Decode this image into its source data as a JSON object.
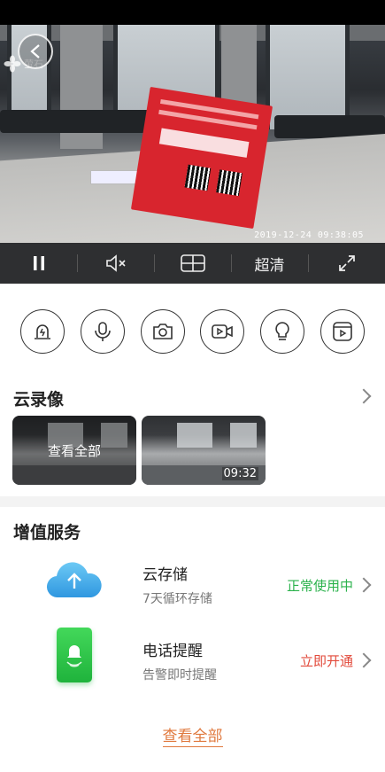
{
  "video": {
    "watermark": "萤石",
    "timestamp": "2019-12-24 09:38:05",
    "sign_title": "智能家居",
    "sign_subtitle": "Home Smart",
    "sign_header": "欢迎订阅《智能家居》杂志"
  },
  "controls": {
    "quality_label": "超清",
    "items": [
      "pause-icon",
      "mute-icon",
      "multi-view-icon",
      "quality",
      "fullscreen-icon"
    ]
  },
  "actions": [
    "alarm-icon",
    "microphone-icon",
    "camera-icon",
    "video-record-icon",
    "light-bulb-icon",
    "playback-icon"
  ],
  "cloud_recording": {
    "title": "云录像",
    "view_all": "查看全部",
    "clip_duration": "09:32"
  },
  "value_services": {
    "title": "增值服务",
    "items": [
      {
        "name": "云存储",
        "desc": "7天循环存储",
        "status": "正常使用中",
        "status_color": "#2bb24c",
        "icon": "cloud-upload-icon"
      },
      {
        "name": "电话提醒",
        "desc": "告警即时提醒",
        "status": "立即开通",
        "status_color": "#e24a3b",
        "icon": "phone-alert-icon"
      }
    ],
    "view_all": "查看全部"
  }
}
